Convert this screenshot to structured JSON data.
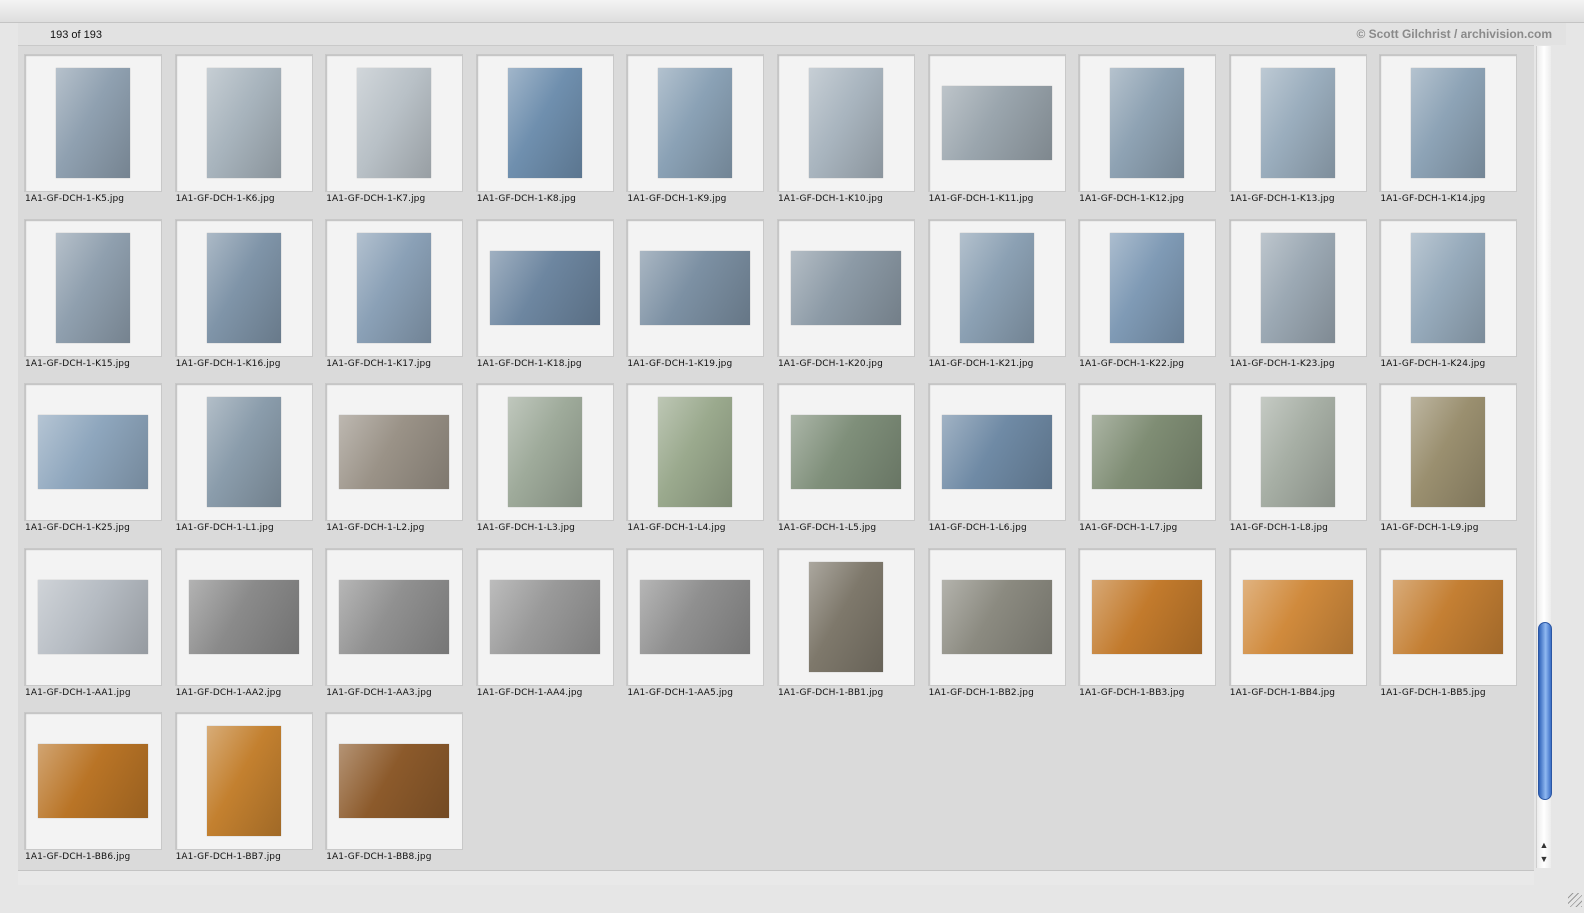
{
  "header": {
    "count": "193 of 193",
    "copyright": "© Scott Gilchrist / archivision.com"
  },
  "colors": {
    "scroll_thumb": "#4a7fd6",
    "background": "#dadada"
  },
  "items": [
    {
      "label": "1A1-GF-DCH-1-K5.jpg",
      "orientation": "portrait",
      "tone": "#8fa0b0"
    },
    {
      "label": "1A1-GF-DCH-1-K6.jpg",
      "orientation": "portrait",
      "tone": "#a8b4bd"
    },
    {
      "label": "1A1-GF-DCH-1-K7.jpg",
      "orientation": "portrait",
      "tone": "#b9c1c7"
    },
    {
      "label": "1A1-GF-DCH-1-K8.jpg",
      "orientation": "portrait",
      "tone": "#6f8fae"
    },
    {
      "label": "1A1-GF-DCH-1-K9.jpg",
      "orientation": "portrait",
      "tone": "#8aa1b5"
    },
    {
      "label": "1A1-GF-DCH-1-K10.jpg",
      "orientation": "portrait",
      "tone": "#a9b5bf"
    },
    {
      "label": "1A1-GF-DCH-1-K11.jpg",
      "orientation": "landscape",
      "tone": "#9aa5ad"
    },
    {
      "label": "1A1-GF-DCH-1-K12.jpg",
      "orientation": "portrait",
      "tone": "#8ea2b3"
    },
    {
      "label": "1A1-GF-DCH-1-K13.jpg",
      "orientation": "portrait",
      "tone": "#9aadbd"
    },
    {
      "label": "1A1-GF-DCH-1-K14.jpg",
      "orientation": "portrait",
      "tone": "#8da3b6"
    },
    {
      "label": "1A1-GF-DCH-1-K15.jpg",
      "orientation": "portrait",
      "tone": "#8f9fae"
    },
    {
      "label": "1A1-GF-DCH-1-K16.jpg",
      "orientation": "portrait",
      "tone": "#7f94a8"
    },
    {
      "label": "1A1-GF-DCH-1-K17.jpg",
      "orientation": "portrait",
      "tone": "#8aa0b6"
    },
    {
      "label": "1A1-GF-DCH-1-K18.jpg",
      "orientation": "landscape",
      "tone": "#6d86a0"
    },
    {
      "label": "1A1-GF-DCH-1-K19.jpg",
      "orientation": "landscape",
      "tone": "#7c90a3"
    },
    {
      "label": "1A1-GF-DCH-1-K20.jpg",
      "orientation": "landscape",
      "tone": "#8c9aa6"
    },
    {
      "label": "1A1-GF-DCH-1-K21.jpg",
      "orientation": "portrait",
      "tone": "#8ba0b3"
    },
    {
      "label": "1A1-GF-DCH-1-K22.jpg",
      "orientation": "portrait",
      "tone": "#7f9ab5"
    },
    {
      "label": "1A1-GF-DCH-1-K23.jpg",
      "orientation": "portrait",
      "tone": "#9ba8b3"
    },
    {
      "label": "1A1-GF-DCH-1-K24.jpg",
      "orientation": "portrait",
      "tone": "#96aabb"
    },
    {
      "label": "1A1-GF-DCH-1-K25.jpg",
      "orientation": "landscape",
      "tone": "#8ea6bd"
    },
    {
      "label": "1A1-GF-DCH-1-L1.jpg",
      "orientation": "portrait",
      "tone": "#8a9cab"
    },
    {
      "label": "1A1-GF-DCH-1-L2.jpg",
      "orientation": "landscape",
      "tone": "#9a9287"
    },
    {
      "label": "1A1-GF-DCH-1-L3.jpg",
      "orientation": "portrait",
      "tone": "#9eaa9a"
    },
    {
      "label": "1A1-GF-DCH-1-L4.jpg",
      "orientation": "portrait",
      "tone": "#9aa98d"
    },
    {
      "label": "1A1-GF-DCH-1-L5.jpg",
      "orientation": "landscape",
      "tone": "#7f8f7a"
    },
    {
      "label": "1A1-GF-DCH-1-L6.jpg",
      "orientation": "landscape",
      "tone": "#6f8aa5"
    },
    {
      "label": "1A1-GF-DCH-1-L7.jpg",
      "orientation": "landscape",
      "tone": "#7f8d74"
    },
    {
      "label": "1A1-GF-DCH-1-L8.jpg",
      "orientation": "portrait",
      "tone": "#a6aea4"
    },
    {
      "label": "1A1-GF-DCH-1-L9.jpg",
      "orientation": "portrait",
      "tone": "#9a8f6f"
    },
    {
      "label": "1A1-GF-DCH-1-AA1.jpg",
      "orientation": "landscape",
      "tone": "#b6bcc3"
    },
    {
      "label": "1A1-GF-DCH-1-AA2.jpg",
      "orientation": "landscape",
      "tone": "#8a8a8a"
    },
    {
      "label": "1A1-GF-DCH-1-AA3.jpg",
      "orientation": "landscape",
      "tone": "#909090"
    },
    {
      "label": "1A1-GF-DCH-1-AA4.jpg",
      "orientation": "landscape",
      "tone": "#999999"
    },
    {
      "label": "1A1-GF-DCH-1-AA5.jpg",
      "orientation": "landscape",
      "tone": "#8f8f8f"
    },
    {
      "label": "1A1-GF-DCH-1-BB1.jpg",
      "orientation": "portrait",
      "tone": "#7e786b"
    },
    {
      "label": "1A1-GF-DCH-1-BB2.jpg",
      "orientation": "landscape",
      "tone": "#8b8a80"
    },
    {
      "label": "1A1-GF-DCH-1-BB3.jpg",
      "orientation": "landscape",
      "tone": "#c27a2c"
    },
    {
      "label": "1A1-GF-DCH-1-BB4.jpg",
      "orientation": "landscape",
      "tone": "#d08a3c"
    },
    {
      "label": "1A1-GF-DCH-1-BB5.jpg",
      "orientation": "landscape",
      "tone": "#c47f33"
    },
    {
      "label": "1A1-GF-DCH-1-BB6.jpg",
      "orientation": "landscape",
      "tone": "#b97426"
    },
    {
      "label": "1A1-GF-DCH-1-BB7.jpg",
      "orientation": "portrait",
      "tone": "#c3802f"
    },
    {
      "label": "1A1-GF-DCH-1-BB8.jpg",
      "orientation": "landscape",
      "tone": "#8c5a2b"
    }
  ]
}
